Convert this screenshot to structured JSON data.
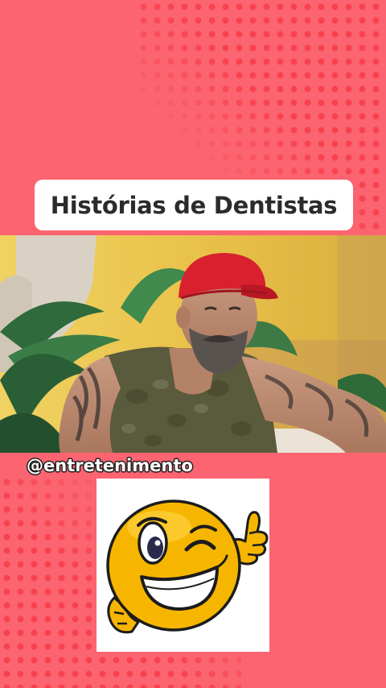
{
  "title": "Histórias de Dentistas",
  "handle": "@entretenimento",
  "icons": {
    "video": "man-with-red-cap-video",
    "sticker": "winking-smiley-thumbs-up-icon"
  },
  "colors": {
    "background": "#fb6470",
    "dots": "#f8414f",
    "title_background": "#ffffff",
    "title_text": "#2b2b2b",
    "cap": "#d8202e",
    "smiley": "#f6b600"
  }
}
